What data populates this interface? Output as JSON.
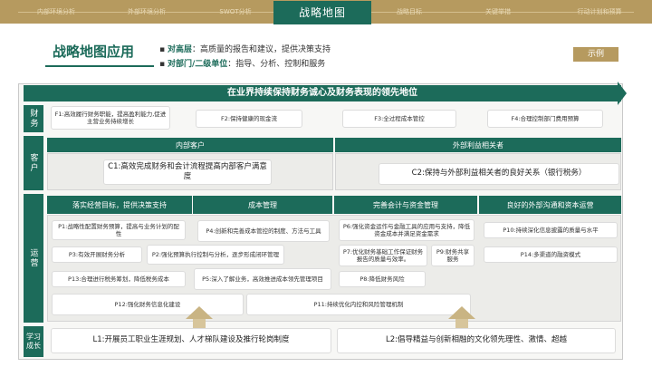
{
  "nav": {
    "items": [
      "内部环境分析",
      "外部环境分析",
      "SWOT分析",
      "战略地图",
      "战略目标",
      "关键举措",
      "行动计划和预算"
    ],
    "active": "战略地图"
  },
  "header": {
    "title": "战略地图应用",
    "bullet1_label": "对高层",
    "bullet1_text": "：高质量的报告和建议，提供决策支持",
    "bullet2_label": "对部门/二级单位",
    "bullet2_text": "：指导、分析、控制和服务",
    "example": "示例"
  },
  "vision": "在业界持续保持财务诚心及财务表现的领先地位",
  "rows": {
    "finance": "财务",
    "customer": "客户",
    "operations": "运营",
    "learning": "学习成长"
  },
  "finance": {
    "f1": "F1:高效履行财务职能，提高盈利能力,促进主营业务持续增长",
    "f2": "F2:保持健康的现金流",
    "f3": "F3:全过程成本管控",
    "f4": "F4:合理控制部门费用预算"
  },
  "customer": {
    "internal": "内部客户",
    "external": "外部利益相关者",
    "c1": "C1:高效完成财务和会计流程提高内部客户满意度",
    "c2": "C2:保持与外部利益相关者的良好关系（银行税务）"
  },
  "operations": {
    "h1": "落实经营目标，提供决策支持",
    "h2": "成本管理",
    "h3": "完善会计与资金管理",
    "h4": "良好的外部沟通和资本运营",
    "p1": "P1:战略性配置财务预算，提高与业务计划的配性",
    "p3": "P3:有效开展财务分析",
    "p13": "P13:合理进行税务筹划，降低税务成本",
    "p4": "P4:创新和完善成本管控的制度、方法与工具",
    "p2": "P2:强化预算执行控制与分析，逐步形成闭环管理",
    "p5": "P5:深入了解业务，高效推进成本领先管理项目",
    "p6": "P6:强化资金运作与金融工具的应用与支持，降低资金成本并满足资金需求",
    "p7": "P7:优化财务基础工作保证财务报告的质量与效率。",
    "p9": "P9:财务共享服务",
    "p8": "P8:降低财务风险",
    "p10": "P10:持续深化信息披露的质量与水平",
    "p14": "P14:多渠道的融资模式",
    "p12": "P12:强化财务信息化建设",
    "p11": "P11:持续优化内控和风险管理机制"
  },
  "learning": {
    "l1": "L1:开展员工职业生涯规划、人才梯队建设及推行轮岗制度",
    "l2": "L2:倡导精益与创新相融的文化领先理性、激情、超越"
  }
}
